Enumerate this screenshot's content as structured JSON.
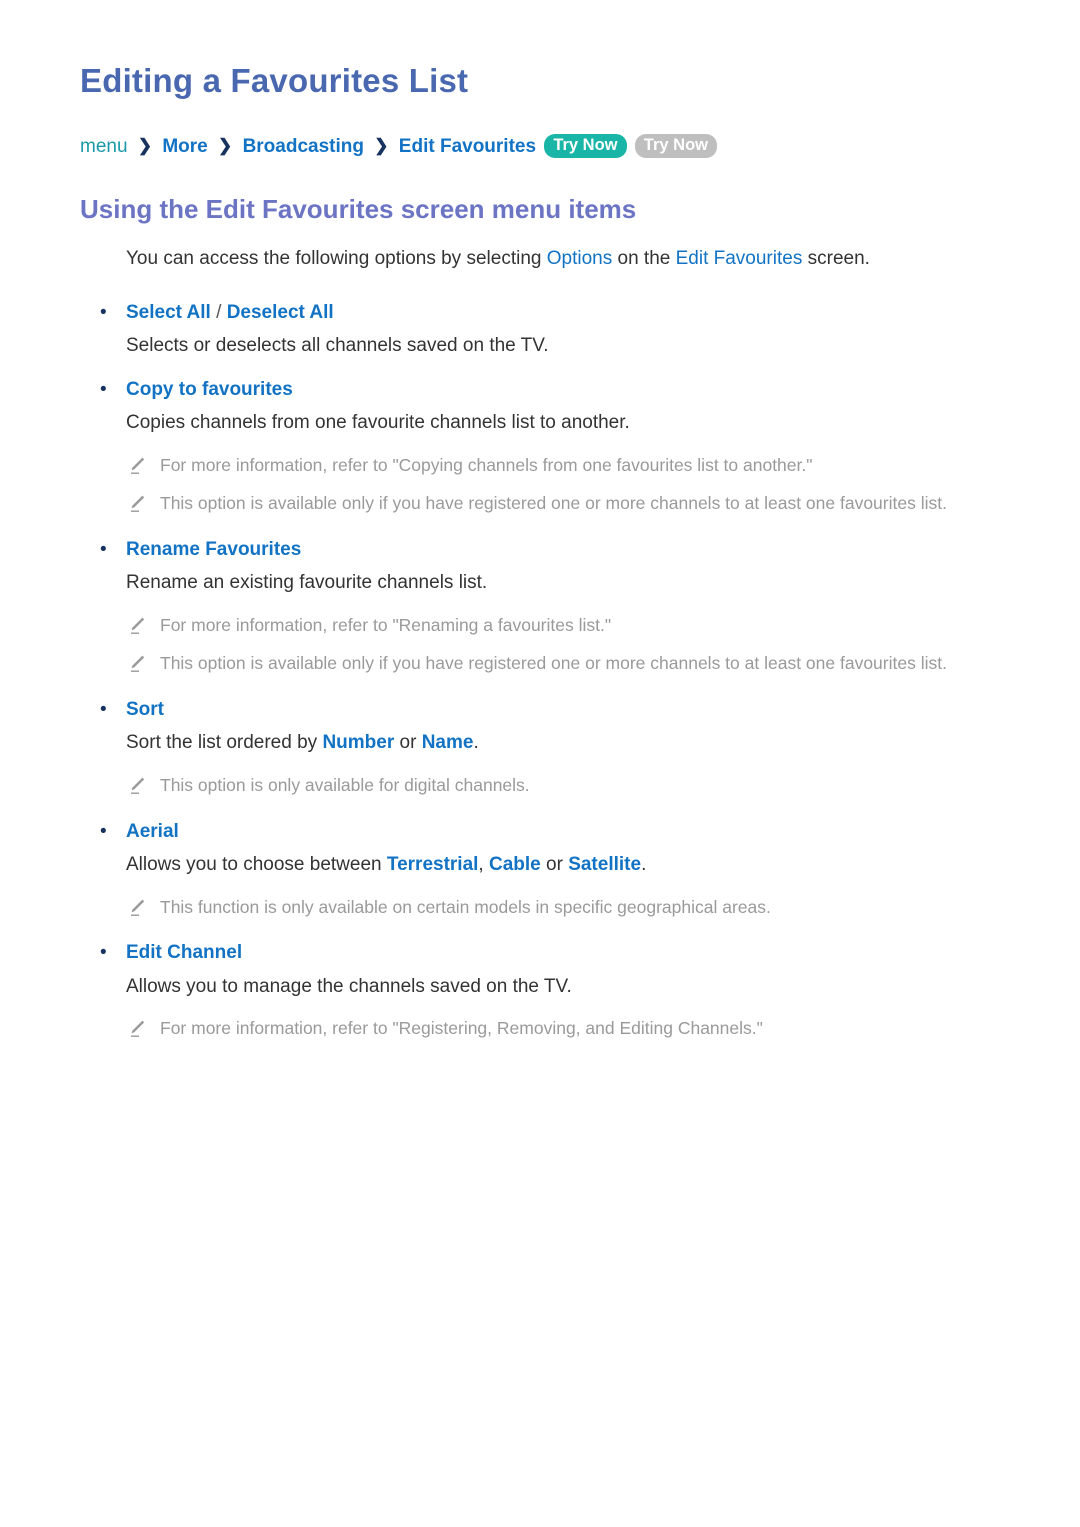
{
  "document": {
    "title": "Editing a Favourites List",
    "breadcrumb": {
      "root": "menu",
      "items": [
        "More",
        "Broadcasting",
        "Edit Favourites"
      ],
      "separator": "❯",
      "badge_primary": "Try Now",
      "badge_secondary": "Try Now"
    },
    "section": {
      "heading": "Using the Edit Favourites screen menu items",
      "intro": {
        "part1": "You can access the following options by selecting ",
        "link1": "Options",
        "part2": " on the ",
        "link2": "Edit Favourites",
        "part3": " screen."
      }
    },
    "options": [
      {
        "title_a": "Select All",
        "separator": " / ",
        "title_b": "Deselect All",
        "description": "Selects or deselects all channels saved on the TV.",
        "notes": []
      },
      {
        "title_a": "Copy to favourites",
        "description": "Copies channels from one favourite channels list to another.",
        "notes": [
          "For more information, refer to \"Copying channels from one favourites list to another.\"",
          "This option is available only if you have registered one or more channels to at least one favourites list."
        ]
      },
      {
        "title_a": "Rename Favourites",
        "description": "Rename an existing favourite channels list.",
        "notes": [
          "For more information, refer to \"Renaming a favourites list.\"",
          "This option is available only if you have registered one or more channels to at least one favourites list."
        ]
      },
      {
        "title_a": "Sort",
        "description_parts": {
          "p1": "Sort the list ordered by ",
          "l1": "Number",
          "p2": " or ",
          "l2": "Name",
          "p3": "."
        },
        "notes": [
          "This option is only available for digital channels."
        ]
      },
      {
        "title_a": "Aerial",
        "description_parts": {
          "p1": "Allows you to choose between ",
          "l1": "Terrestrial",
          "p2": ", ",
          "l2": "Cable",
          "p3": " or ",
          "l3": "Satellite",
          "p4": "."
        },
        "notes": [
          "This function is only available on certain models in specific geographical areas."
        ]
      },
      {
        "title_a": "Edit Channel",
        "description": "Allows you to manage the channels saved on the TV.",
        "notes": [
          "For more information, refer to \"Registering, Removing, and Editing Channels.\""
        ]
      }
    ],
    "colors": {
      "title": "#4a68b0",
      "section_heading": "#6c74c4",
      "link": "#1273c4",
      "menu_root": "#1a9aa8",
      "badge_primary": "#19b6a8",
      "badge_secondary": "#bfbfbf",
      "note_text": "#9a9a9a",
      "body_text": "#333333"
    },
    "icons": {
      "note": "pencil-icon",
      "bullet": "bullet-dot-icon",
      "separator": "chevron-right-icon"
    }
  }
}
